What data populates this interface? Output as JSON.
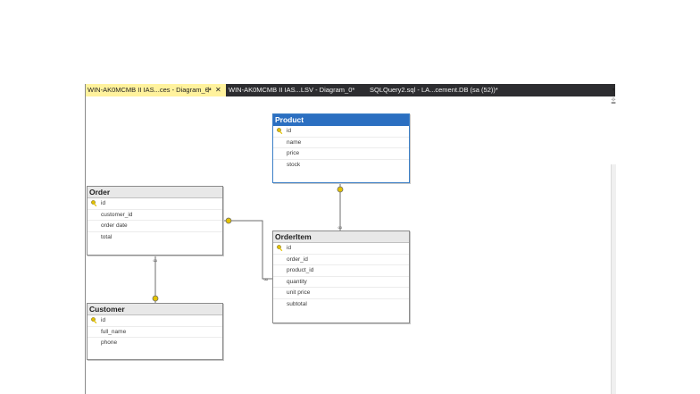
{
  "tabs": [
    {
      "label": "WIN-AK0MCMB II IAS...ces - Diagram_0*",
      "active": true,
      "pin_icon": "pin-icon",
      "close_icon": "close-icon"
    },
    {
      "label": "WIN-AK0MCMB II IAS...LSV - Diagram_0*",
      "active": false
    },
    {
      "label": "SQLQuery2.sql - LA...cement.DB (sa (52))*",
      "active": false
    }
  ],
  "colors": {
    "tab_strip": "#2d2d30",
    "active_tab": "#fff29d",
    "selected_table_header": "#2b6fc1",
    "relationship_key": "#e3c200"
  },
  "tables": {
    "product": {
      "name": "Product",
      "selected": true,
      "columns": [
        {
          "name": "id",
          "primary_key": true
        },
        {
          "name": "name"
        },
        {
          "name": "price"
        },
        {
          "name": "stock"
        }
      ]
    },
    "order": {
      "name": "Order",
      "selected": false,
      "columns": [
        {
          "name": "id",
          "primary_key": true
        },
        {
          "name": "customer_id"
        },
        {
          "name": "order date"
        },
        {
          "name": "total"
        }
      ]
    },
    "orderitem": {
      "name": "OrderItem",
      "selected": false,
      "columns": [
        {
          "name": "id",
          "primary_key": true
        },
        {
          "name": "order_id"
        },
        {
          "name": "product_id"
        },
        {
          "name": "quantity"
        },
        {
          "name": "unit price"
        },
        {
          "name": "subtotal"
        }
      ]
    },
    "customer": {
      "name": "Customer",
      "selected": false,
      "columns": [
        {
          "name": "id",
          "primary_key": true
        },
        {
          "name": "full_name"
        },
        {
          "name": "phone"
        }
      ]
    }
  },
  "relationships": [
    {
      "from": "Product",
      "to": "OrderItem",
      "one_end": "Product",
      "many_end": "OrderItem"
    },
    {
      "from": "Order",
      "to": "OrderItem",
      "one_end": "Order",
      "many_end": "OrderItem"
    },
    {
      "from": "Customer",
      "to": "Order",
      "one_end": "Customer",
      "many_end": "Order"
    }
  ]
}
